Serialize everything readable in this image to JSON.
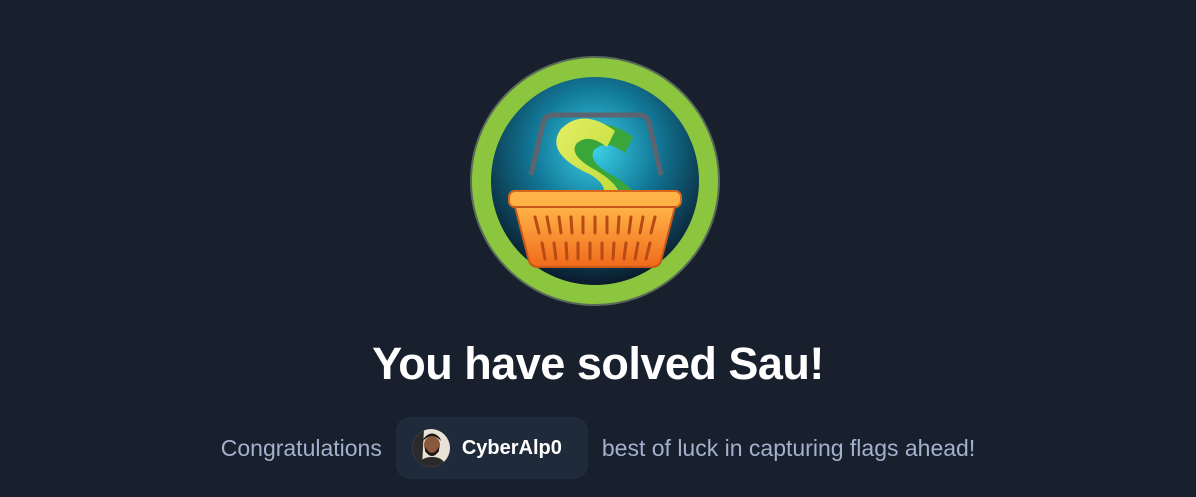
{
  "machine": {
    "name": "Sau",
    "title": "You have solved Sau!",
    "badge_icon": "shopping-basket-dollar-icon"
  },
  "message": {
    "before": "Congratulations",
    "after": "best of luck in capturing flags ahead!"
  },
  "user": {
    "username": "CyberAlp0",
    "avatar_icon": "user-avatar"
  },
  "colors": {
    "background": "#181f2d",
    "ring": "#8cc63f",
    "chip": "#1f2a3a",
    "muted_text": "#a4b1cd"
  }
}
